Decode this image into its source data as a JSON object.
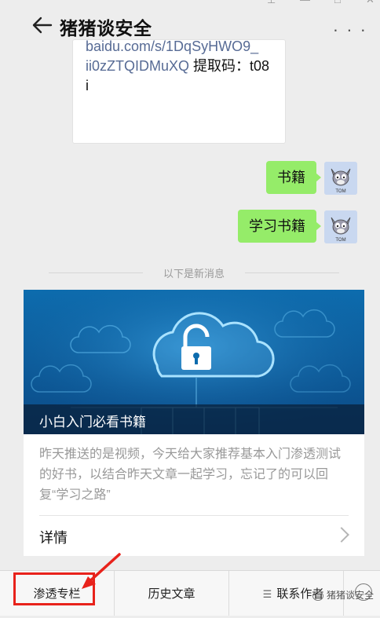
{
  "header": {
    "title": "猪猪谈安全"
  },
  "prev_card": {
    "link_line1": "baidu.com/s/1DqSyHWO9_",
    "link_line2_url": "ii0zZTQIDMuXQ",
    "link_line2_text": " 提取码：t08",
    "line3": "i"
  },
  "messages": [
    {
      "text": "书籍"
    },
    {
      "text": "学习书籍"
    }
  ],
  "avatar_label": "TOM",
  "divider_text": "以下是新消息",
  "article": {
    "caption": "小白入门必看书籍",
    "summary": "昨天推送的是视频，今天给大家推荐基本入门渗透测试的好书，以结合昨天文章一起学习，忘记了的可以回复“学习之路”",
    "detail_label": "详情"
  },
  "bottom_menu": {
    "items": [
      {
        "label": "渗透专栏"
      },
      {
        "label": "历史文章"
      },
      {
        "label": "联系作者"
      }
    ]
  },
  "watermark": "猪猪谈安全",
  "colors": {
    "bubble": "#95ec69",
    "link": "#576b95",
    "highlight": "#e8221b"
  }
}
